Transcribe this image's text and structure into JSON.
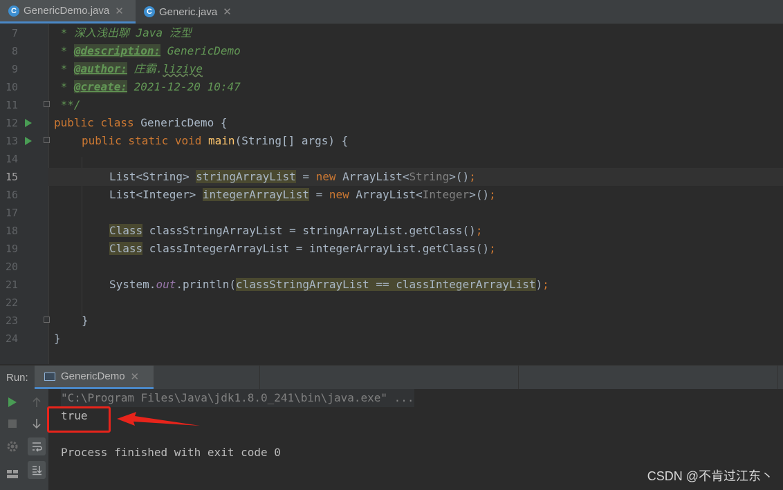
{
  "tabs": [
    {
      "label": "GenericDemo.java",
      "icon": "java-class-icon",
      "active": true
    },
    {
      "label": "Generic.java",
      "icon": "java-class-icon",
      "active": false
    }
  ],
  "editor": {
    "lines": [
      {
        "n": "7"
      },
      {
        "n": "8"
      },
      {
        "n": "9"
      },
      {
        "n": "10"
      },
      {
        "n": "11"
      },
      {
        "n": "12"
      },
      {
        "n": "13"
      },
      {
        "n": "14"
      },
      {
        "n": "15"
      },
      {
        "n": "16"
      },
      {
        "n": "17"
      },
      {
        "n": "18"
      },
      {
        "n": "19"
      },
      {
        "n": "20"
      },
      {
        "n": "21"
      },
      {
        "n": "22"
      },
      {
        "n": "23"
      },
      {
        "n": "24"
      }
    ],
    "code": {
      "l7_star": " * ",
      "l7_text": "深入浅出聊 Java 泛型",
      "l8_tag": "@description:",
      "l8_text": " GenericDemo",
      "l9_tag": "@author:",
      "l9_text1": " 庄霸.",
      "l9_text2": "liziye",
      "l10_tag": "@create:",
      "l10_text": " 2021-12-20 10:47",
      "l11": " **/",
      "l12_kw": "public class ",
      "l12_name": "GenericDemo {",
      "l13_kw": "public static void ",
      "l13_fn": "main",
      "l13_rest": "(String[] args) {",
      "l15_type": "List<String> ",
      "l15_var": "stringArrayList",
      "l15_eq": " = ",
      "l15_new": "new ",
      "l15_cls": "ArrayList<",
      "l15_gen": "String",
      "l15_end": ">()",
      "l15_semi": ";",
      "l16_type": "List<Integer> ",
      "l16_var": "integerArrayList",
      "l16_eq": " = ",
      "l16_new": "new ",
      "l16_cls": "ArrayList<",
      "l16_gen": "Integer",
      "l16_end": ">()",
      "l16_semi": ";",
      "l18_cls": "Class",
      "l18_rest": " classStringArrayList = stringArrayList.getClass()",
      "l18_semi": ";",
      "l19_cls": "Class",
      "l19_rest": " classIntegerArrayList = integerArrayList.getClass()",
      "l19_semi": ";",
      "l21_sys": "System.",
      "l21_out": "out",
      "l21_pr": ".println(",
      "l21_arg": "classStringArrayList == classIntegerArrayList",
      "l21_end": ")",
      "l21_semi": ";",
      "l23": "}",
      "l24": "}"
    }
  },
  "run": {
    "label": "Run:",
    "tab_label": "GenericDemo",
    "console": {
      "cmd": "\"C:\\Program Files\\Java\\jdk1.8.0_241\\bin\\java.exe\" ...",
      "output": "true",
      "exit": "Process finished with exit code 0"
    }
  },
  "watermark": "CSDN @不肯过江东丶",
  "colors": {
    "annotation": "#e8241b",
    "run_green": "#499c54",
    "accent_blue": "#4a88c7"
  }
}
